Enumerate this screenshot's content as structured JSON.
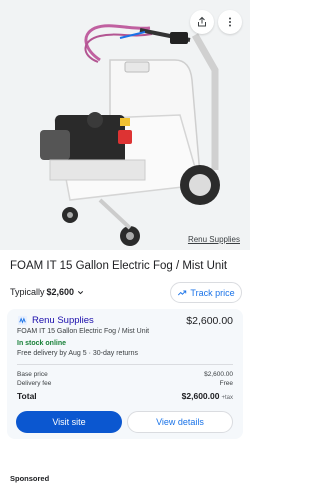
{
  "hero": {
    "source_tag": "Renu Supplies",
    "share_icon": "share-icon",
    "more_icon": "more-vert-icon"
  },
  "product": {
    "title": "FOAM IT 15 Gallon Electric Fog / Mist Unit"
  },
  "pricing": {
    "typically_label": "Typically",
    "typical_price": "$2,600",
    "track_price_label": "Track price"
  },
  "offer": {
    "store_name": "Renu Supplies",
    "price": "$2,600.00",
    "product_line": "FOAM IT 15 Gallon Electric Fog / Mist Unit",
    "stock_status": "In stock online",
    "delivery": "Free delivery by Aug 5 · 30-day returns",
    "base_price_label": "Base price",
    "base_price_value": "$2,600.00",
    "delivery_fee_label": "Delivery fee",
    "delivery_fee_value": "Free",
    "total_label": "Total",
    "total_value": "$2,600.00",
    "tax_label": "+tax",
    "visit_site_label": "Visit site",
    "view_details_label": "View details"
  },
  "footer": {
    "sponsored_label": "Sponsored"
  },
  "colors": {
    "accent": "#1a73e8",
    "primary_button": "#0b57d0",
    "in_stock": "#188038",
    "store_link": "#1a0dab"
  }
}
